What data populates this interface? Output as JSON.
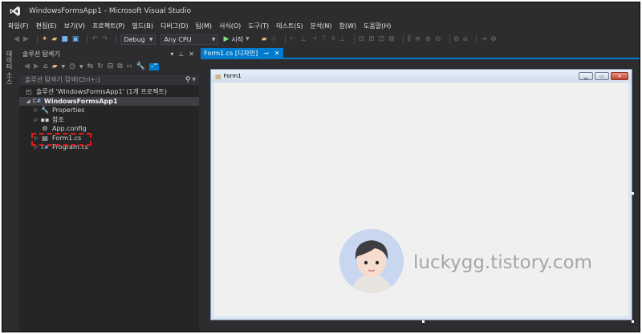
{
  "window": {
    "title": "WindowsFormsApp1 - Microsoft Visual Studio"
  },
  "menu": [
    "파일(F)",
    "편집(E)",
    "보기(V)",
    "프로젝트(P)",
    "빌드(B)",
    "디버그(D)",
    "팀(M)",
    "서식(O)",
    "도구(T)",
    "테스트(S)",
    "분석(N)",
    "창(W)",
    "도움말(H)"
  ],
  "toolbar": {
    "config": "Debug",
    "platform": "Any CPU",
    "start_label": "시작"
  },
  "side_strip": {
    "label": "데이터 소스"
  },
  "solution_explorer": {
    "title": "솔루션 탐색기",
    "search_placeholder": "솔루션 탐색기 검색(Ctrl+;)",
    "tree": [
      {
        "label": "솔루션 'WindowsFormsApp1' (1개 프로젝트)",
        "icon": "solution-icon"
      },
      {
        "label": "WindowsFormsApp1",
        "icon": "csharp-project-icon"
      },
      {
        "label": "Properties",
        "icon": "wrench-icon"
      },
      {
        "label": "참조",
        "icon": "references-icon"
      },
      {
        "label": "App.config",
        "icon": "config-file-icon"
      },
      {
        "label": "Form1.cs",
        "icon": "form-file-icon"
      },
      {
        "label": "Program.cs",
        "icon": "csharp-file-icon"
      }
    ]
  },
  "designer": {
    "tab_label": "Form1.cs [디자인]",
    "form_title": "Form1"
  },
  "watermark": {
    "text": "luckygg.tistory.com"
  },
  "colors": {
    "ide_background": "#2d2d30",
    "panel_background": "#252526",
    "accent": "#007acc",
    "highlight_box": "#e31a1a"
  }
}
